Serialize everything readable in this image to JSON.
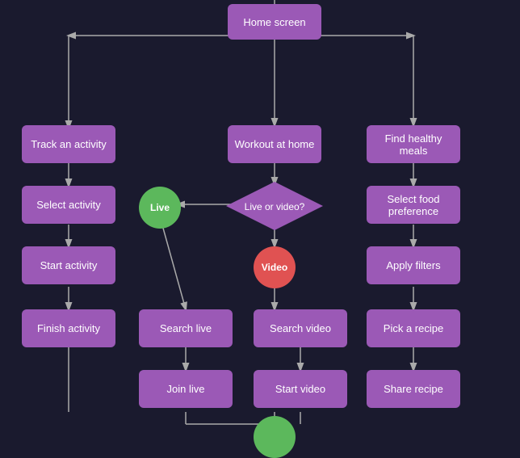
{
  "nodes": {
    "home_screen": {
      "label": "Home screen"
    },
    "track_activity": {
      "label": "Track an activity"
    },
    "workout_home": {
      "label": "Workout at home"
    },
    "find_healthy": {
      "label": "Find healthy meals"
    },
    "select_activity": {
      "label": "Select activity"
    },
    "live_or_video": {
      "label": "Live or video?"
    },
    "select_food": {
      "label": "Select food preference"
    },
    "start_activity": {
      "label": "Start activity"
    },
    "live": {
      "label": "Live"
    },
    "video": {
      "label": "Video"
    },
    "apply_filters": {
      "label": "Apply filters"
    },
    "finish_activity": {
      "label": "Finish activity"
    },
    "search_live": {
      "label": "Search live"
    },
    "search_video": {
      "label": "Search video"
    },
    "pick_recipe": {
      "label": "Pick a recipe"
    },
    "join_live": {
      "label": "Join live"
    },
    "start_video": {
      "label": "Start video"
    },
    "share_recipe": {
      "label": "Share recipe"
    }
  },
  "colors": {
    "background": "#1a1a2e",
    "node_purple": "#9b59b6",
    "node_green": "#5cb85c",
    "node_red": "#e05252",
    "arrow": "#aaaaaa",
    "text": "#ffffff"
  }
}
